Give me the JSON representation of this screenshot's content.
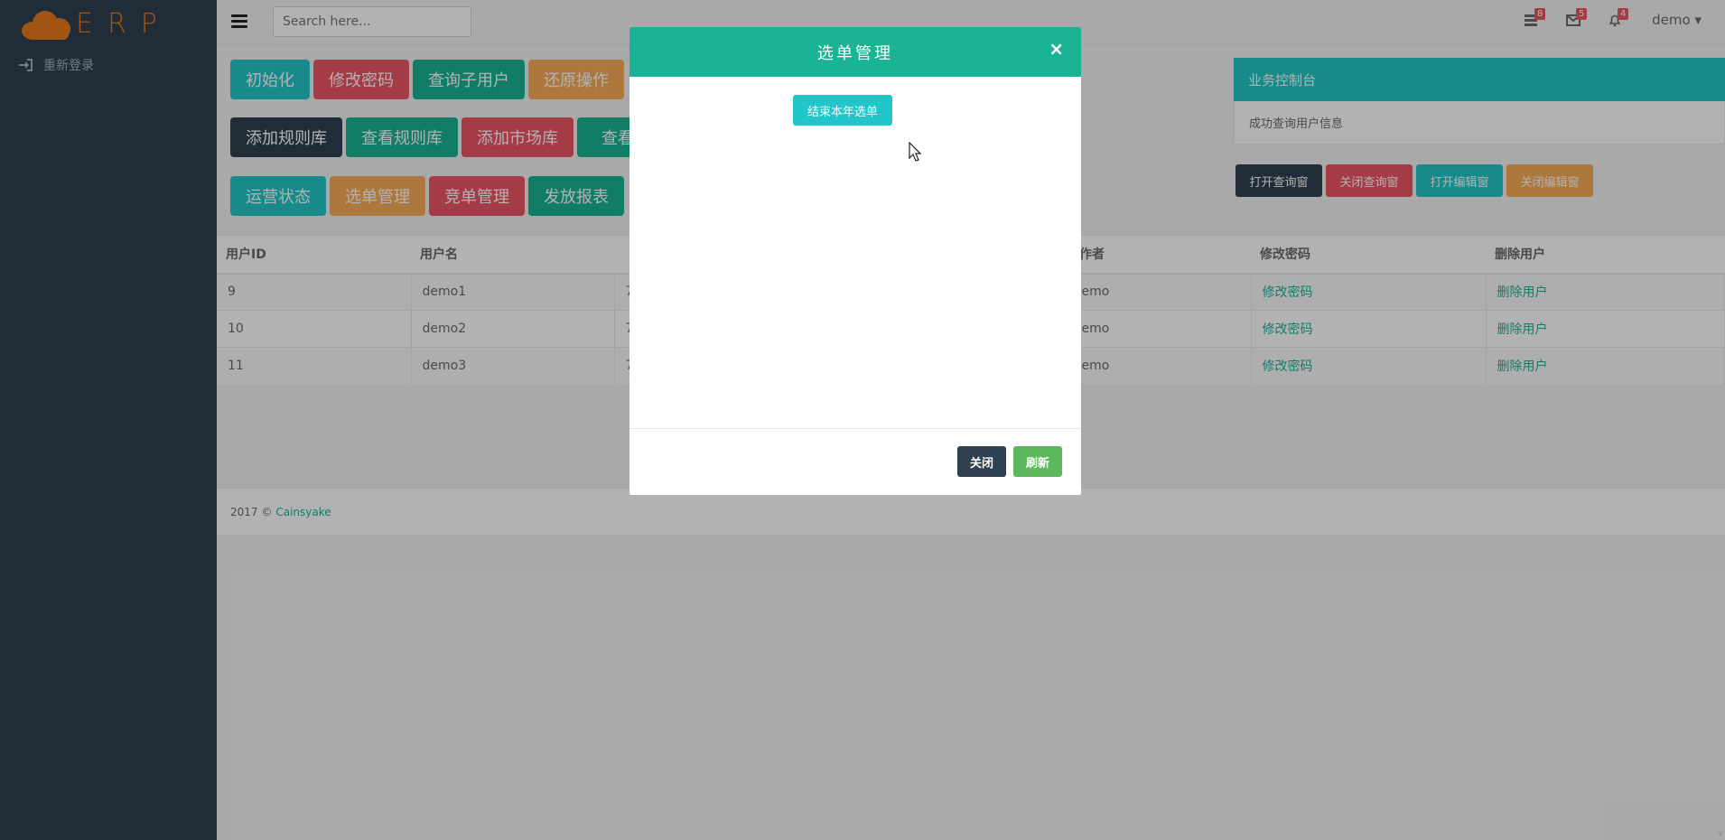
{
  "app": {
    "logo_text": "ERP"
  },
  "sidebar": {
    "items": [
      {
        "label": "重新登录",
        "icon": "sign-in-icon"
      }
    ]
  },
  "topbar": {
    "search_placeholder": "Search here...",
    "badges": [
      {
        "icon": "tasks-icon",
        "count": "8"
      },
      {
        "icon": "envelope-icon",
        "count": "5"
      },
      {
        "icon": "bell-icon",
        "count": "4"
      }
    ],
    "user": "demo"
  },
  "actions": {
    "row1": [
      "初始化",
      "修改密码",
      "查询子用户",
      "还原操作"
    ],
    "row2": [
      "添加规则库",
      "查看规则库",
      "添加市场库",
      "查看"
    ],
    "row3": [
      "运营状态",
      "选单管理",
      "竞单管理",
      "发放报表"
    ]
  },
  "console": {
    "title": "业务控制台",
    "message": "成功查询用户信息",
    "buttons": [
      "打开查询窗",
      "关闭查询窗",
      "打开编辑窗",
      "关闭编辑窗"
    ]
  },
  "table": {
    "headers": [
      "用户ID",
      "用户名",
      "",
      "作者",
      "修改密码",
      "删除用户"
    ],
    "rows": [
      {
        "id": "9",
        "name": "demo1",
        "col3": "7",
        "author": "emo",
        "pwd": "修改密码",
        "del": "删除用户"
      },
      {
        "id": "10",
        "name": "demo2",
        "col3": "7",
        "author": "emo",
        "pwd": "修改密码",
        "del": "删除用户"
      },
      {
        "id": "11",
        "name": "demo3",
        "col3": "7",
        "author": "emo",
        "pwd": "修改密码",
        "del": "删除用户"
      }
    ]
  },
  "footer": {
    "text": "2017 ©",
    "link": "Cainsyake"
  },
  "modal": {
    "title": "选单管理",
    "close_symbol": "×",
    "end_button": "结束本年选单",
    "close_button": "关闭",
    "refresh_button": "刷新"
  },
  "colors": {
    "sidebar": "#2f4050",
    "primary": "#1ab394",
    "info": "#23c6c8",
    "danger": "#ed5565",
    "warning": "#f8ac59",
    "logo": "#e8791c"
  }
}
